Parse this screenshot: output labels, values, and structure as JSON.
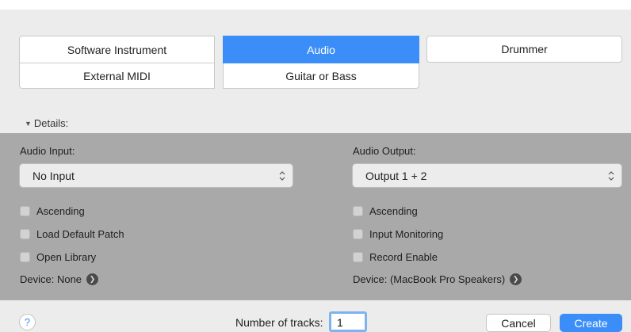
{
  "track_types": {
    "software_instrument": "Software Instrument",
    "audio": "Audio",
    "drummer": "Drummer",
    "external_midi": "External MIDI",
    "guitar_or_bass": "Guitar or Bass",
    "selected": "audio"
  },
  "details": {
    "label": "Details:"
  },
  "input": {
    "label": "Audio Input:",
    "value": "No Input",
    "options": [
      {
        "label": "Ascending",
        "checked": false
      },
      {
        "label": "Load Default Patch",
        "checked": false
      },
      {
        "label": "Open Library",
        "checked": false
      }
    ],
    "device": "Device: None"
  },
  "output": {
    "label": "Audio Output:",
    "value": "Output 1 + 2",
    "options": [
      {
        "label": "Ascending",
        "checked": false
      },
      {
        "label": "Input Monitoring",
        "checked": false
      },
      {
        "label": "Record Enable",
        "checked": false
      }
    ],
    "device": "Device: (MacBook Pro Speakers)"
  },
  "footer": {
    "help": "?",
    "tracks_label": "Number of tracks:",
    "tracks_value": "1",
    "cancel": "Cancel",
    "create": "Create"
  },
  "colors": {
    "accent": "#3b8ef7",
    "panel": "#a9a9a9",
    "background": "#ececec"
  },
  "icons": {
    "popup_arrows": "up-down-chevron-icon",
    "device_go": "chevron-right-circle-icon"
  }
}
